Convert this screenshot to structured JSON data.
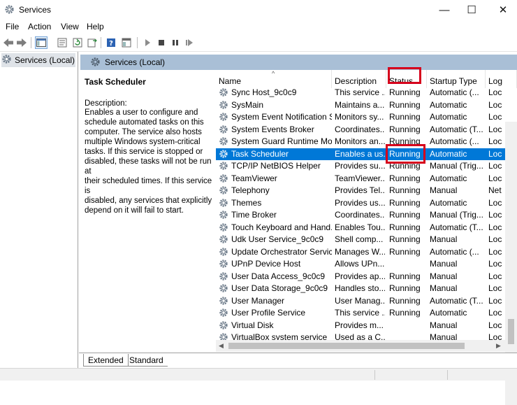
{
  "window": {
    "title": "Services"
  },
  "window_controls": {
    "minimize": "—",
    "maximize": "☐",
    "close": "✕"
  },
  "menu": [
    "File",
    "Action",
    "View",
    "Help"
  ],
  "toolbar_icons": [
    "back-icon",
    "forward-icon",
    "console-tree-icon",
    "properties-icon",
    "refresh-icon",
    "export-list-icon",
    "help-icon",
    "show-hide-pane-icon",
    "start-service-icon",
    "stop-service-icon",
    "pause-service-icon",
    "restart-service-icon"
  ],
  "tree": {
    "selected_label": "Services (Local)"
  },
  "main_header": {
    "label": "Services (Local)"
  },
  "description_panel": {
    "title": "Task Scheduler",
    "description_label": "Description:",
    "description_lines": [
      "Enables a user to configure and",
      "schedule automated tasks on this",
      "computer. The service also hosts",
      "multiple Windows system-critical",
      "tasks. If this service is stopped or",
      "disabled, these tasks will not be run at",
      "their scheduled times. If this service is",
      "disabled, any services that explicitly",
      "depend on it will fail to start."
    ]
  },
  "columns": {
    "name": "Name",
    "description": "Description",
    "status": "Status",
    "startup_type": "Startup Type",
    "log_on_as": "Log"
  },
  "rows": [
    {
      "name": "Sync Host_9c0c9",
      "description": "This service ...",
      "status": "Running",
      "startup": "Automatic (...",
      "logon": "Loc"
    },
    {
      "name": "SysMain",
      "description": "Maintains a...",
      "status": "Running",
      "startup": "Automatic",
      "logon": "Loc"
    },
    {
      "name": "System Event Notification S...",
      "description": "Monitors sy...",
      "status": "Running",
      "startup": "Automatic",
      "logon": "Loc"
    },
    {
      "name": "System Events Broker",
      "description": "Coordinates...",
      "status": "Running",
      "startup": "Automatic (T...",
      "logon": "Loc"
    },
    {
      "name": "System Guard Runtime Mo...",
      "description": "Monitors an...",
      "status": "Running",
      "startup": "Automatic (...",
      "logon": "Loc"
    },
    {
      "name": "Task Scheduler",
      "description": "Enables a us...",
      "status": "Running",
      "startup": "Automatic",
      "logon": "Loc",
      "selected": true
    },
    {
      "name": "TCP/IP NetBIOS Helper",
      "description": "Provides su...",
      "status": "Running",
      "startup": "Manual (Trig...",
      "logon": "Loc"
    },
    {
      "name": "TeamViewer",
      "description": "TeamViewer...",
      "status": "Running",
      "startup": "Automatic",
      "logon": "Loc"
    },
    {
      "name": "Telephony",
      "description": "Provides Tel...",
      "status": "Running",
      "startup": "Manual",
      "logon": "Net"
    },
    {
      "name": "Themes",
      "description": "Provides us...",
      "status": "Running",
      "startup": "Automatic",
      "logon": "Loc"
    },
    {
      "name": "Time Broker",
      "description": "Coordinates...",
      "status": "Running",
      "startup": "Manual (Trig...",
      "logon": "Loc"
    },
    {
      "name": "Touch Keyboard and Hand...",
      "description": "Enables Tou...",
      "status": "Running",
      "startup": "Automatic (T...",
      "logon": "Loc"
    },
    {
      "name": "Udk User Service_9c0c9",
      "description": "Shell comp...",
      "status": "Running",
      "startup": "Manual",
      "logon": "Loc"
    },
    {
      "name": "Update Orchestrator Service",
      "description": "Manages W...",
      "status": "Running",
      "startup": "Automatic (...",
      "logon": "Loc"
    },
    {
      "name": "UPnP Device Host",
      "description": "Allows UPn...",
      "status": "",
      "startup": "Manual",
      "logon": "Loc"
    },
    {
      "name": "User Data Access_9c0c9",
      "description": "Provides ap...",
      "status": "Running",
      "startup": "Manual",
      "logon": "Loc"
    },
    {
      "name": "User Data Storage_9c0c9",
      "description": "Handles sto...",
      "status": "Running",
      "startup": "Manual",
      "logon": "Loc"
    },
    {
      "name": "User Manager",
      "description": "User Manag...",
      "status": "Running",
      "startup": "Automatic (T...",
      "logon": "Loc"
    },
    {
      "name": "User Profile Service",
      "description": "This service ...",
      "status": "Running",
      "startup": "Automatic",
      "logon": "Loc"
    },
    {
      "name": "Virtual Disk",
      "description": "Provides m...",
      "status": "",
      "startup": "Manual",
      "logon": "Loc"
    },
    {
      "name": "VirtualBox system service",
      "description": "Used as a C...",
      "status": "",
      "startup": "Manual",
      "logon": "Loc"
    }
  ],
  "tabs": {
    "extended": "Extended",
    "standard": "Standard"
  },
  "colors": {
    "selection": "#0078d7",
    "header_band": "#a9bfd6",
    "highlight_box": "#d6001c"
  }
}
